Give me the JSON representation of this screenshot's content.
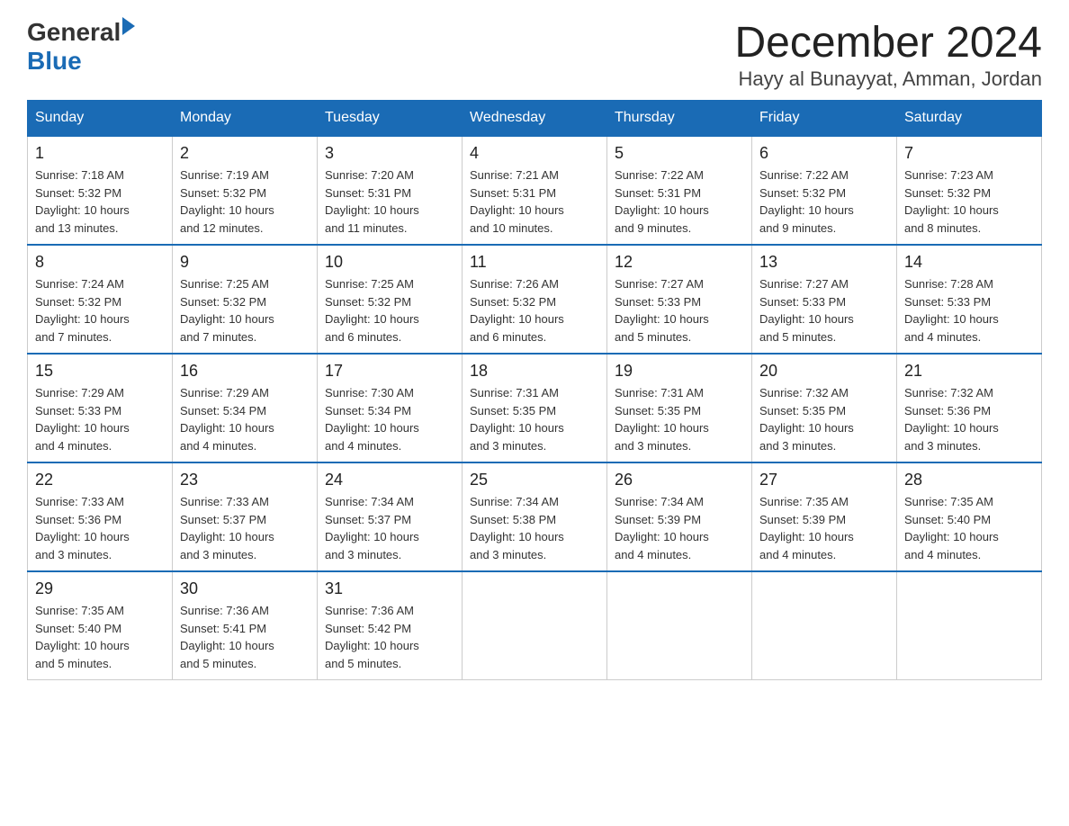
{
  "header": {
    "logo_general": "General",
    "logo_blue": "Blue",
    "month_title": "December 2024",
    "location": "Hayy al Bunayyat, Amman, Jordan"
  },
  "days_of_week": [
    "Sunday",
    "Monday",
    "Tuesday",
    "Wednesday",
    "Thursday",
    "Friday",
    "Saturday"
  ],
  "weeks": [
    [
      {
        "day": "1",
        "sunrise": "7:18 AM",
        "sunset": "5:32 PM",
        "daylight": "10 hours and 13 minutes."
      },
      {
        "day": "2",
        "sunrise": "7:19 AM",
        "sunset": "5:32 PM",
        "daylight": "10 hours and 12 minutes."
      },
      {
        "day": "3",
        "sunrise": "7:20 AM",
        "sunset": "5:31 PM",
        "daylight": "10 hours and 11 minutes."
      },
      {
        "day": "4",
        "sunrise": "7:21 AM",
        "sunset": "5:31 PM",
        "daylight": "10 hours and 10 minutes."
      },
      {
        "day": "5",
        "sunrise": "7:22 AM",
        "sunset": "5:31 PM",
        "daylight": "10 hours and 9 minutes."
      },
      {
        "day": "6",
        "sunrise": "7:22 AM",
        "sunset": "5:32 PM",
        "daylight": "10 hours and 9 minutes."
      },
      {
        "day": "7",
        "sunrise": "7:23 AM",
        "sunset": "5:32 PM",
        "daylight": "10 hours and 8 minutes."
      }
    ],
    [
      {
        "day": "8",
        "sunrise": "7:24 AM",
        "sunset": "5:32 PM",
        "daylight": "10 hours and 7 minutes."
      },
      {
        "day": "9",
        "sunrise": "7:25 AM",
        "sunset": "5:32 PM",
        "daylight": "10 hours and 7 minutes."
      },
      {
        "day": "10",
        "sunrise": "7:25 AM",
        "sunset": "5:32 PM",
        "daylight": "10 hours and 6 minutes."
      },
      {
        "day": "11",
        "sunrise": "7:26 AM",
        "sunset": "5:32 PM",
        "daylight": "10 hours and 6 minutes."
      },
      {
        "day": "12",
        "sunrise": "7:27 AM",
        "sunset": "5:33 PM",
        "daylight": "10 hours and 5 minutes."
      },
      {
        "day": "13",
        "sunrise": "7:27 AM",
        "sunset": "5:33 PM",
        "daylight": "10 hours and 5 minutes."
      },
      {
        "day": "14",
        "sunrise": "7:28 AM",
        "sunset": "5:33 PM",
        "daylight": "10 hours and 4 minutes."
      }
    ],
    [
      {
        "day": "15",
        "sunrise": "7:29 AM",
        "sunset": "5:33 PM",
        "daylight": "10 hours and 4 minutes."
      },
      {
        "day": "16",
        "sunrise": "7:29 AM",
        "sunset": "5:34 PM",
        "daylight": "10 hours and 4 minutes."
      },
      {
        "day": "17",
        "sunrise": "7:30 AM",
        "sunset": "5:34 PM",
        "daylight": "10 hours and 4 minutes."
      },
      {
        "day": "18",
        "sunrise": "7:31 AM",
        "sunset": "5:35 PM",
        "daylight": "10 hours and 3 minutes."
      },
      {
        "day": "19",
        "sunrise": "7:31 AM",
        "sunset": "5:35 PM",
        "daylight": "10 hours and 3 minutes."
      },
      {
        "day": "20",
        "sunrise": "7:32 AM",
        "sunset": "5:35 PM",
        "daylight": "10 hours and 3 minutes."
      },
      {
        "day": "21",
        "sunrise": "7:32 AM",
        "sunset": "5:36 PM",
        "daylight": "10 hours and 3 minutes."
      }
    ],
    [
      {
        "day": "22",
        "sunrise": "7:33 AM",
        "sunset": "5:36 PM",
        "daylight": "10 hours and 3 minutes."
      },
      {
        "day": "23",
        "sunrise": "7:33 AM",
        "sunset": "5:37 PM",
        "daylight": "10 hours and 3 minutes."
      },
      {
        "day": "24",
        "sunrise": "7:34 AM",
        "sunset": "5:37 PM",
        "daylight": "10 hours and 3 minutes."
      },
      {
        "day": "25",
        "sunrise": "7:34 AM",
        "sunset": "5:38 PM",
        "daylight": "10 hours and 3 minutes."
      },
      {
        "day": "26",
        "sunrise": "7:34 AM",
        "sunset": "5:39 PM",
        "daylight": "10 hours and 4 minutes."
      },
      {
        "day": "27",
        "sunrise": "7:35 AM",
        "sunset": "5:39 PM",
        "daylight": "10 hours and 4 minutes."
      },
      {
        "day": "28",
        "sunrise": "7:35 AM",
        "sunset": "5:40 PM",
        "daylight": "10 hours and 4 minutes."
      }
    ],
    [
      {
        "day": "29",
        "sunrise": "7:35 AM",
        "sunset": "5:40 PM",
        "daylight": "10 hours and 5 minutes."
      },
      {
        "day": "30",
        "sunrise": "7:36 AM",
        "sunset": "5:41 PM",
        "daylight": "10 hours and 5 minutes."
      },
      {
        "day": "31",
        "sunrise": "7:36 AM",
        "sunset": "5:42 PM",
        "daylight": "10 hours and 5 minutes."
      },
      null,
      null,
      null,
      null
    ]
  ],
  "labels": {
    "sunrise": "Sunrise:",
    "sunset": "Sunset:",
    "daylight": "Daylight:"
  }
}
